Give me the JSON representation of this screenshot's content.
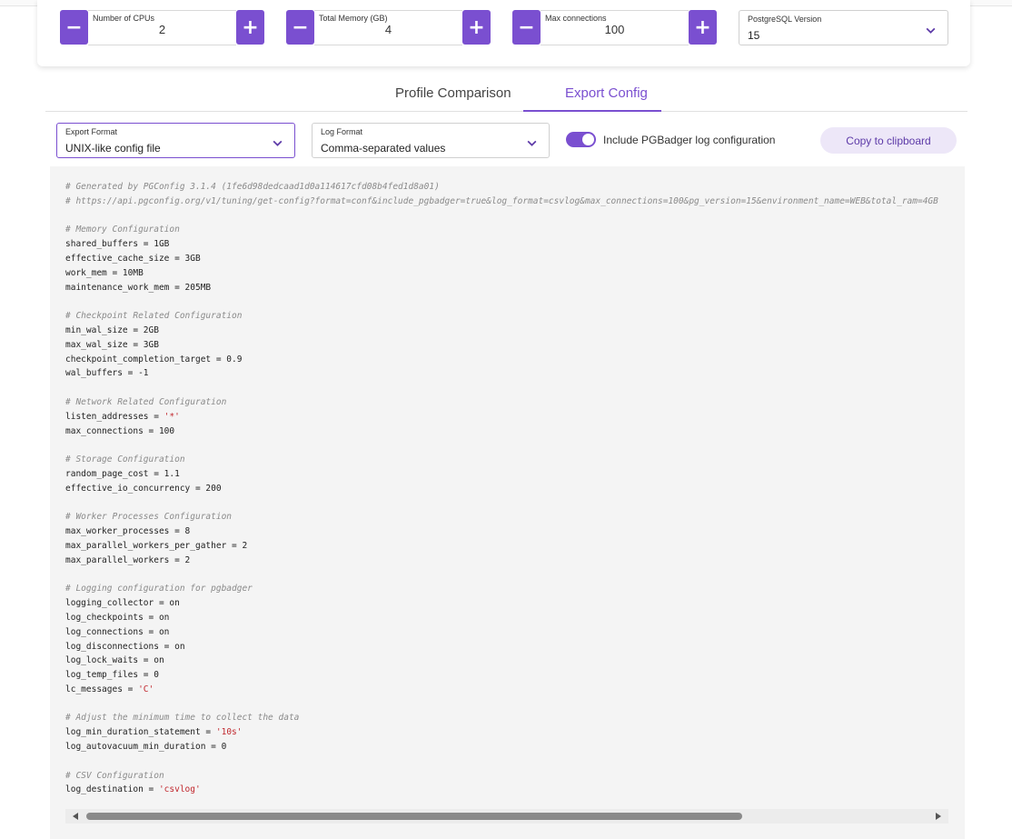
{
  "inputs": {
    "cpus": {
      "label": "Number of CPUs",
      "value": "2",
      "minus": "−",
      "plus": "+"
    },
    "memory": {
      "label": "Total Memory (GB)",
      "value": "4",
      "minus": "−",
      "plus": "+"
    },
    "connections": {
      "label": "Max connections",
      "value": "100",
      "minus": "−",
      "plus": "+"
    },
    "pg_version": {
      "label": "PostgreSQL Version",
      "value": "15"
    }
  },
  "tabs": [
    {
      "label": "Profile Comparison",
      "active": false
    },
    {
      "label": "Export Config",
      "active": true
    }
  ],
  "export": {
    "format_label": "Export Format",
    "format_value": "UNIX-like config file",
    "log_label": "Log Format",
    "log_value": "Comma-separated values",
    "toggle_label": "Include PGBadger log configuration",
    "toggle_on": true,
    "copy_label": "Copy to clipboard"
  },
  "colors": {
    "accent": "#7a4fd0",
    "code_bg": "#f4f4f4",
    "comment": "#8a8a8a",
    "string": "#c1272d"
  },
  "config_lines": [
    {
      "segments": [
        {
          "text": "# Generated by PGConfig 3.1.4 (1fe6d98dedcaad1d0a114617cfd08b4fed1d8a01)",
          "kind": "comment"
        }
      ]
    },
    {
      "segments": [
        {
          "text": "# https://api.pgconfig.org/v1/tuning/get-config?format=conf&include_pgbadger=true&log_format=csvlog&max_connections=100&pg_version=15&environment_name=WEB&total_ram=4GB",
          "kind": "comment"
        }
      ]
    },
    {
      "segments": []
    },
    {
      "segments": [
        {
          "text": "# Memory Configuration",
          "kind": "comment"
        }
      ]
    },
    {
      "segments": [
        {
          "text": "shared_buffers = 1GB",
          "kind": "plain"
        }
      ]
    },
    {
      "segments": [
        {
          "text": "effective_cache_size = 3GB",
          "kind": "plain"
        }
      ]
    },
    {
      "segments": [
        {
          "text": "work_mem = 10MB",
          "kind": "plain"
        }
      ]
    },
    {
      "segments": [
        {
          "text": "maintenance_work_mem = 205MB",
          "kind": "plain"
        }
      ]
    },
    {
      "segments": []
    },
    {
      "segments": [
        {
          "text": "# Checkpoint Related Configuration",
          "kind": "comment"
        }
      ]
    },
    {
      "segments": [
        {
          "text": "min_wal_size = 2GB",
          "kind": "plain"
        }
      ]
    },
    {
      "segments": [
        {
          "text": "max_wal_size = 3GB",
          "kind": "plain"
        }
      ]
    },
    {
      "segments": [
        {
          "text": "checkpoint_completion_target = 0.9",
          "kind": "plain"
        }
      ]
    },
    {
      "segments": [
        {
          "text": "wal_buffers = -1",
          "kind": "plain"
        }
      ]
    },
    {
      "segments": []
    },
    {
      "segments": [
        {
          "text": "# Network Related Configuration",
          "kind": "comment"
        }
      ]
    },
    {
      "segments": [
        {
          "text": "listen_addresses = ",
          "kind": "plain"
        },
        {
          "text": "'*'",
          "kind": "string"
        }
      ]
    },
    {
      "segments": [
        {
          "text": "max_connections = 100",
          "kind": "plain"
        }
      ]
    },
    {
      "segments": []
    },
    {
      "segments": [
        {
          "text": "# Storage Configuration",
          "kind": "comment"
        }
      ]
    },
    {
      "segments": [
        {
          "text": "random_page_cost = 1.1",
          "kind": "plain"
        }
      ]
    },
    {
      "segments": [
        {
          "text": "effective_io_concurrency = 200",
          "kind": "plain"
        }
      ]
    },
    {
      "segments": []
    },
    {
      "segments": [
        {
          "text": "# Worker Processes Configuration",
          "kind": "comment"
        }
      ]
    },
    {
      "segments": [
        {
          "text": "max_worker_processes = 8",
          "kind": "plain"
        }
      ]
    },
    {
      "segments": [
        {
          "text": "max_parallel_workers_per_gather = 2",
          "kind": "plain"
        }
      ]
    },
    {
      "segments": [
        {
          "text": "max_parallel_workers = 2",
          "kind": "plain"
        }
      ]
    },
    {
      "segments": []
    },
    {
      "segments": [
        {
          "text": "# Logging configuration for pgbadger",
          "kind": "comment"
        }
      ]
    },
    {
      "segments": [
        {
          "text": "logging_collector = on",
          "kind": "plain"
        }
      ]
    },
    {
      "segments": [
        {
          "text": "log_checkpoints = on",
          "kind": "plain"
        }
      ]
    },
    {
      "segments": [
        {
          "text": "log_connections = on",
          "kind": "plain"
        }
      ]
    },
    {
      "segments": [
        {
          "text": "log_disconnections = on",
          "kind": "plain"
        }
      ]
    },
    {
      "segments": [
        {
          "text": "log_lock_waits = on",
          "kind": "plain"
        }
      ]
    },
    {
      "segments": [
        {
          "text": "log_temp_files = 0",
          "kind": "plain"
        }
      ]
    },
    {
      "segments": [
        {
          "text": "lc_messages = ",
          "kind": "plain"
        },
        {
          "text": "'C'",
          "kind": "string"
        }
      ]
    },
    {
      "segments": []
    },
    {
      "segments": [
        {
          "text": "# Adjust the minimum time to collect the data",
          "kind": "comment"
        }
      ]
    },
    {
      "segments": [
        {
          "text": "log_min_duration_statement = ",
          "kind": "plain"
        },
        {
          "text": "'10s'",
          "kind": "string"
        }
      ]
    },
    {
      "segments": [
        {
          "text": "log_autovacuum_min_duration = 0",
          "kind": "plain"
        }
      ]
    },
    {
      "segments": []
    },
    {
      "segments": [
        {
          "text": "# CSV Configuration",
          "kind": "comment"
        }
      ]
    },
    {
      "segments": [
        {
          "text": "log_destination = ",
          "kind": "plain"
        },
        {
          "text": "'csvlog'",
          "kind": "string"
        }
      ]
    }
  ]
}
